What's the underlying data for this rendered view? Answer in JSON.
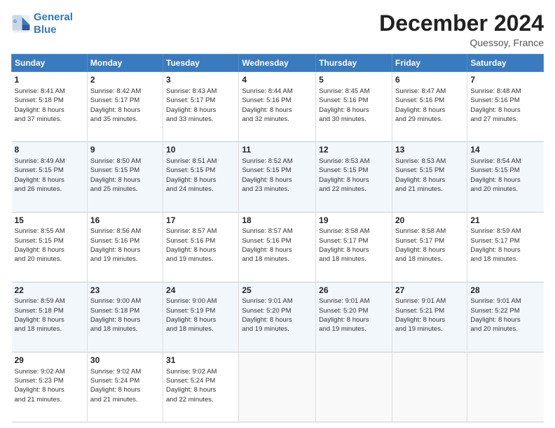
{
  "header": {
    "logo_line1": "General",
    "logo_line2": "Blue",
    "month": "December 2024",
    "location": "Quessoy, France"
  },
  "days_of_week": [
    "Sunday",
    "Monday",
    "Tuesday",
    "Wednesday",
    "Thursday",
    "Friday",
    "Saturday"
  ],
  "weeks": [
    [
      {
        "day": "1",
        "lines": [
          "Sunrise: 8:41 AM",
          "Sunset: 5:18 PM",
          "Daylight: 8 hours",
          "and 37 minutes."
        ]
      },
      {
        "day": "2",
        "lines": [
          "Sunrise: 8:42 AM",
          "Sunset: 5:17 PM",
          "Daylight: 8 hours",
          "and 35 minutes."
        ]
      },
      {
        "day": "3",
        "lines": [
          "Sunrise: 8:43 AM",
          "Sunset: 5:17 PM",
          "Daylight: 8 hours",
          "and 33 minutes."
        ]
      },
      {
        "day": "4",
        "lines": [
          "Sunrise: 8:44 AM",
          "Sunset: 5:16 PM",
          "Daylight: 8 hours",
          "and 32 minutes."
        ]
      },
      {
        "day": "5",
        "lines": [
          "Sunrise: 8:45 AM",
          "Sunset: 5:16 PM",
          "Daylight: 8 hours",
          "and 30 minutes."
        ]
      },
      {
        "day": "6",
        "lines": [
          "Sunrise: 8:47 AM",
          "Sunset: 5:16 PM",
          "Daylight: 8 hours",
          "and 29 minutes."
        ]
      },
      {
        "day": "7",
        "lines": [
          "Sunrise: 8:48 AM",
          "Sunset: 5:16 PM",
          "Daylight: 8 hours",
          "and 27 minutes."
        ]
      }
    ],
    [
      {
        "day": "8",
        "lines": [
          "Sunrise: 8:49 AM",
          "Sunset: 5:15 PM",
          "Daylight: 8 hours",
          "and 26 minutes."
        ]
      },
      {
        "day": "9",
        "lines": [
          "Sunrise: 8:50 AM",
          "Sunset: 5:15 PM",
          "Daylight: 8 hours",
          "and 25 minutes."
        ]
      },
      {
        "day": "10",
        "lines": [
          "Sunrise: 8:51 AM",
          "Sunset: 5:15 PM",
          "Daylight: 8 hours",
          "and 24 minutes."
        ]
      },
      {
        "day": "11",
        "lines": [
          "Sunrise: 8:52 AM",
          "Sunset: 5:15 PM",
          "Daylight: 8 hours",
          "and 23 minutes."
        ]
      },
      {
        "day": "12",
        "lines": [
          "Sunrise: 8:53 AM",
          "Sunset: 5:15 PM",
          "Daylight: 8 hours",
          "and 22 minutes."
        ]
      },
      {
        "day": "13",
        "lines": [
          "Sunrise: 8:53 AM",
          "Sunset: 5:15 PM",
          "Daylight: 8 hours",
          "and 21 minutes."
        ]
      },
      {
        "day": "14",
        "lines": [
          "Sunrise: 8:54 AM",
          "Sunset: 5:15 PM",
          "Daylight: 8 hours",
          "and 20 minutes."
        ]
      }
    ],
    [
      {
        "day": "15",
        "lines": [
          "Sunrise: 8:55 AM",
          "Sunset: 5:15 PM",
          "Daylight: 8 hours",
          "and 20 minutes."
        ]
      },
      {
        "day": "16",
        "lines": [
          "Sunrise: 8:56 AM",
          "Sunset: 5:16 PM",
          "Daylight: 8 hours",
          "and 19 minutes."
        ]
      },
      {
        "day": "17",
        "lines": [
          "Sunrise: 8:57 AM",
          "Sunset: 5:16 PM",
          "Daylight: 8 hours",
          "and 19 minutes."
        ]
      },
      {
        "day": "18",
        "lines": [
          "Sunrise: 8:57 AM",
          "Sunset: 5:16 PM",
          "Daylight: 8 hours",
          "and 18 minutes."
        ]
      },
      {
        "day": "19",
        "lines": [
          "Sunrise: 8:58 AM",
          "Sunset: 5:17 PM",
          "Daylight: 8 hours",
          "and 18 minutes."
        ]
      },
      {
        "day": "20",
        "lines": [
          "Sunrise: 8:58 AM",
          "Sunset: 5:17 PM",
          "Daylight: 8 hours",
          "and 18 minutes."
        ]
      },
      {
        "day": "21",
        "lines": [
          "Sunrise: 8:59 AM",
          "Sunset: 5:17 PM",
          "Daylight: 8 hours",
          "and 18 minutes."
        ]
      }
    ],
    [
      {
        "day": "22",
        "lines": [
          "Sunrise: 8:59 AM",
          "Sunset: 5:18 PM",
          "Daylight: 8 hours",
          "and 18 minutes."
        ]
      },
      {
        "day": "23",
        "lines": [
          "Sunrise: 9:00 AM",
          "Sunset: 5:18 PM",
          "Daylight: 8 hours",
          "and 18 minutes."
        ]
      },
      {
        "day": "24",
        "lines": [
          "Sunrise: 9:00 AM",
          "Sunset: 5:19 PM",
          "Daylight: 8 hours",
          "and 18 minutes."
        ]
      },
      {
        "day": "25",
        "lines": [
          "Sunrise: 9:01 AM",
          "Sunset: 5:20 PM",
          "Daylight: 8 hours",
          "and 19 minutes."
        ]
      },
      {
        "day": "26",
        "lines": [
          "Sunrise: 9:01 AM",
          "Sunset: 5:20 PM",
          "Daylight: 8 hours",
          "and 19 minutes."
        ]
      },
      {
        "day": "27",
        "lines": [
          "Sunrise: 9:01 AM",
          "Sunset: 5:21 PM",
          "Daylight: 8 hours",
          "and 19 minutes."
        ]
      },
      {
        "day": "28",
        "lines": [
          "Sunrise: 9:01 AM",
          "Sunset: 5:22 PM",
          "Daylight: 8 hours",
          "and 20 minutes."
        ]
      }
    ],
    [
      {
        "day": "29",
        "lines": [
          "Sunrise: 9:02 AM",
          "Sunset: 5:23 PM",
          "Daylight: 8 hours",
          "and 21 minutes."
        ]
      },
      {
        "day": "30",
        "lines": [
          "Sunrise: 9:02 AM",
          "Sunset: 5:24 PM",
          "Daylight: 8 hours",
          "and 21 minutes."
        ]
      },
      {
        "day": "31",
        "lines": [
          "Sunrise: 9:02 AM",
          "Sunset: 5:24 PM",
          "Daylight: 8 hours",
          "and 22 minutes."
        ]
      },
      null,
      null,
      null,
      null
    ]
  ]
}
